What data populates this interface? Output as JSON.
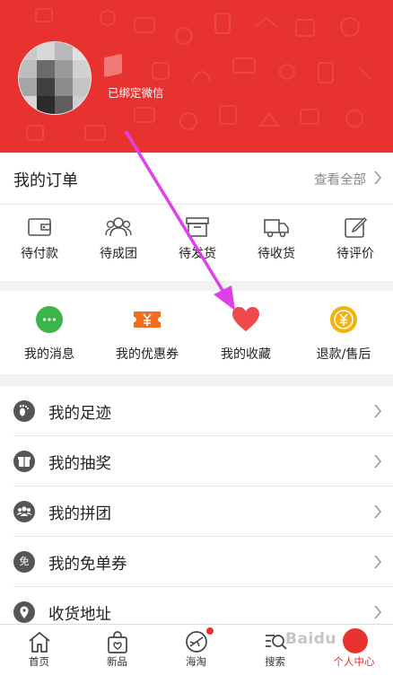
{
  "profile": {
    "wechat_status": "已绑定微信"
  },
  "orders": {
    "title": "我的订单",
    "view_all": "查看全部",
    "items": [
      {
        "label": "待付款",
        "icon": "wallet-icon"
      },
      {
        "label": "待成团",
        "icon": "group-icon"
      },
      {
        "label": "待发货",
        "icon": "box-icon"
      },
      {
        "label": "待收货",
        "icon": "truck-icon"
      },
      {
        "label": "待评价",
        "icon": "edit-icon"
      }
    ]
  },
  "services": {
    "items": [
      {
        "label": "我的消息",
        "icon": "message-icon",
        "color": "#3cb44a"
      },
      {
        "label": "我的优惠券",
        "icon": "coupon-icon",
        "color": "#f46c1e"
      },
      {
        "label": "我的收藏",
        "icon": "heart-icon",
        "color": "#ef4a4a"
      },
      {
        "label": "退款/售后",
        "icon": "refund-icon",
        "color": "#f5b20c"
      }
    ]
  },
  "menu": {
    "items": [
      {
        "label": "我的足迹",
        "icon": "footprint-icon"
      },
      {
        "label": "我的抽奖",
        "icon": "lottery-icon"
      },
      {
        "label": "我的拼团",
        "icon": "group-buy-icon"
      },
      {
        "label": "我的免单券",
        "icon": "free-coupon-icon",
        "glyph": "免"
      },
      {
        "label": "收货地址",
        "icon": "location-icon"
      }
    ]
  },
  "tabbar": {
    "items": [
      {
        "label": "首页",
        "icon": "home-icon"
      },
      {
        "label": "新品",
        "icon": "new-bag-icon"
      },
      {
        "label": "海淘",
        "icon": "plane-icon"
      },
      {
        "label": "搜索",
        "icon": "search-icon"
      },
      {
        "label": "个人中心",
        "icon": "profile-icon",
        "active": true
      }
    ]
  },
  "colors": {
    "brand": "#e8322f",
    "annotation": "#e040e8"
  }
}
